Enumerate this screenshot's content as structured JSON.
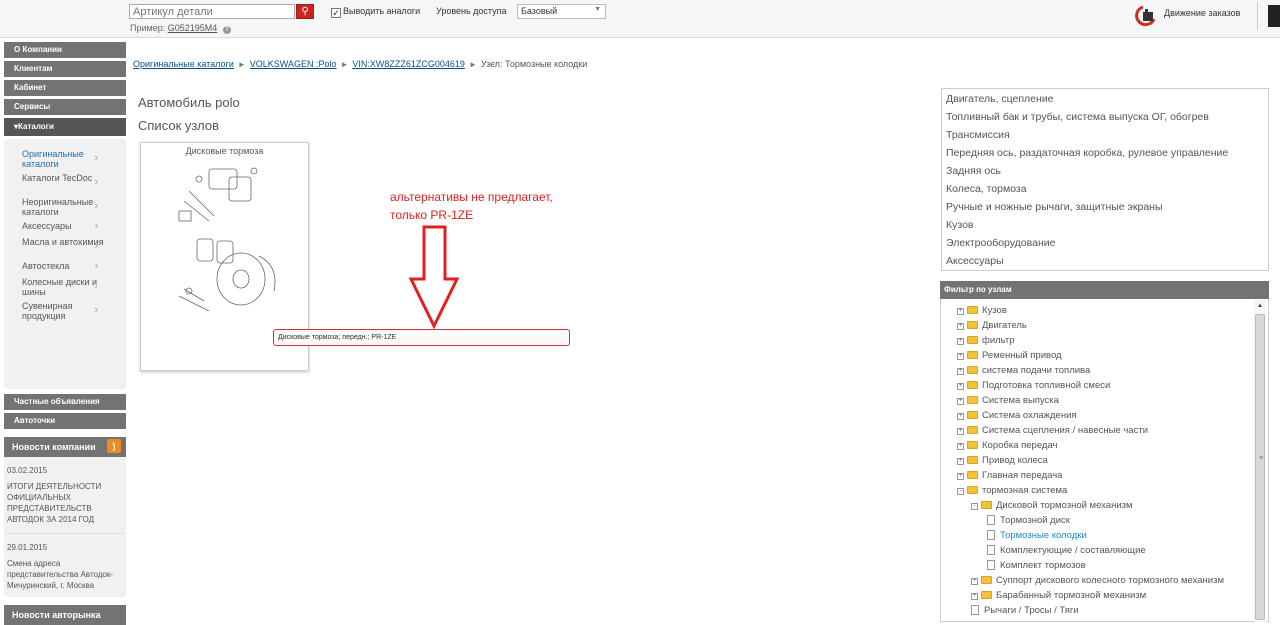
{
  "topbar": {
    "search_placeholder": "Артикул детали",
    "search_icon": "search-icon",
    "example_label": "Пример:",
    "example_value": "G052195M4",
    "analogs_label": "Выводить аналоги",
    "analogs_checked": true,
    "access_label": "Уровень доступа",
    "access_value": "Базовый",
    "orders_link": "Движение заказов"
  },
  "sidebar": {
    "menu": [
      {
        "label": "О Компании"
      },
      {
        "label": "Клиентам"
      },
      {
        "label": "Кабинет"
      },
      {
        "label": "Сервисы"
      },
      {
        "label": "Каталоги"
      }
    ],
    "catalog_items": [
      {
        "label": "Оригинальные каталоги"
      },
      {
        "label": "Каталоги TecDoc"
      },
      {
        "label": "Неоригинальные каталоги"
      },
      {
        "label": "Аксессуары"
      },
      {
        "label": "Масла и автохимия"
      },
      {
        "label": "Автостекла"
      },
      {
        "label": "Колесные диски и шины"
      },
      {
        "label": "Сувенирная продукция"
      }
    ],
    "menu2": [
      {
        "label": "Частные объявления"
      },
      {
        "label": "Автоточки"
      }
    ],
    "news_title": "Новости компании",
    "news": [
      {
        "date": "03.02.2015",
        "text": "ИТОГИ ДЕЯТЕЛЬНОСТИ ОФИЦИАЛЬНЫХ ПРЕДСТАВИТЕЛЬСТВ АВТОДОК ЗА 2014 ГОД"
      },
      {
        "date": "29.01.2015",
        "text": "Смена адреса представительства Автодок-Мичуринский, г. Москва"
      }
    ],
    "news2_title": "Новости авторынка"
  },
  "breadcrumb": {
    "c1": "Оригинальные каталоги",
    "c2": "VOLKSWAGEN :Polo",
    "c3": "VIN:XW8ZZZ61ZCG004619",
    "c4": "Узел: Тормозные колодки",
    "sep": "►"
  },
  "main": {
    "car_title": "Автомобиль polo",
    "nodes_title": "Список узлов",
    "card_title": "Дисковые тормоза",
    "tooltip": "Дисковые тормоза; передн.; PR-1ZE",
    "annotation_line1": "альтернативы не предлагает,",
    "annotation_line2": "только PR-1ZE"
  },
  "groups": [
    "Двигатель, сцепление",
    "Топливный бак и трубы, система выпуска ОГ, обогрев",
    "Трансмиссия",
    "Передняя ось, раздаточная коробка, рулевое управление",
    "Задняя ось",
    "Колеса, тормоза",
    "Ручные и ножные рычаги, защитные экраны",
    "Кузов",
    "Электрооборудование",
    "Аксессуары"
  ],
  "filter": {
    "title": "Фильтр по узлам",
    "tree": [
      {
        "label": "Кузов",
        "level": 0,
        "type": "folder",
        "pm": "+"
      },
      {
        "label": "Двигатель",
        "level": 0,
        "type": "folder",
        "pm": "+"
      },
      {
        "label": "фильтр",
        "level": 0,
        "type": "folder",
        "pm": "+"
      },
      {
        "label": "Ременный привод",
        "level": 0,
        "type": "folder",
        "pm": "+"
      },
      {
        "label": "система подачи топлива",
        "level": 0,
        "type": "folder",
        "pm": "+"
      },
      {
        "label": "Подготовка топливной смеси",
        "level": 0,
        "type": "folder",
        "pm": "+"
      },
      {
        "label": "Система выпуска",
        "level": 0,
        "type": "folder",
        "pm": "+"
      },
      {
        "label": "Система охлаждения",
        "level": 0,
        "type": "folder",
        "pm": "+"
      },
      {
        "label": "Система сцепления / навесные части",
        "level": 0,
        "type": "folder",
        "pm": "+"
      },
      {
        "label": "Коробка передач",
        "level": 0,
        "type": "folder",
        "pm": "+"
      },
      {
        "label": "Привод колеса",
        "level": 0,
        "type": "folder",
        "pm": "+"
      },
      {
        "label": "Главная передача",
        "level": 0,
        "type": "folder",
        "pm": "+"
      },
      {
        "label": "тормозная система",
        "level": 0,
        "type": "folder",
        "pm": "-"
      },
      {
        "label": "Дисковой тормозной механизм",
        "level": 1,
        "type": "folder",
        "pm": "-"
      },
      {
        "label": "Тормозной диск",
        "level": 2,
        "type": "doc",
        "pm": ""
      },
      {
        "label": "Тормозные колодки",
        "level": 2,
        "type": "doc",
        "pm": "",
        "selected": true
      },
      {
        "label": "Комплектующие / составляющие",
        "level": 2,
        "type": "doc",
        "pm": ""
      },
      {
        "label": "Комплект тормозов",
        "level": 2,
        "type": "doc",
        "pm": ""
      },
      {
        "label": "Суппорт дискового колесного тормозного механизм",
        "level": 1,
        "type": "folder",
        "pm": "+"
      },
      {
        "label": "Барабанный тормозной механизм",
        "level": 1,
        "type": "folder",
        "pm": "+"
      },
      {
        "label": "Рычаги / Тросы / Тяги",
        "level": 1,
        "type": "doc",
        "pm": ""
      }
    ]
  },
  "colors": {
    "accent_red": "#c9261f",
    "menu_gray": "#737373",
    "link_blue": "#0a4f8a",
    "selected_blue": "#1a8ad0",
    "annotation_red": "#e02020"
  }
}
